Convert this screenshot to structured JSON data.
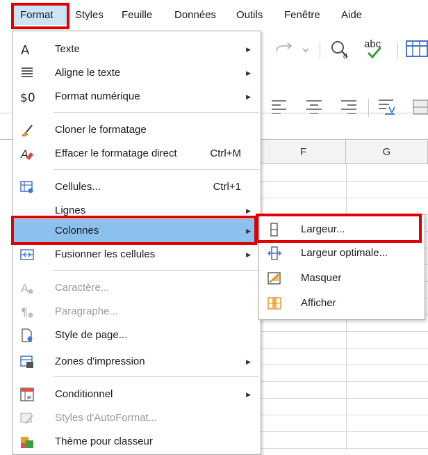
{
  "menubar": {
    "items": [
      {
        "label": "Format",
        "accel": "t"
      },
      {
        "label": "Styles",
        "accel": "y"
      },
      {
        "label": "Feuille",
        "accel": "u"
      },
      {
        "label": "Données",
        "accel": "s"
      },
      {
        "label": "Outils",
        "accel": "O"
      },
      {
        "label": "Fenêtre",
        "accel": "ê"
      },
      {
        "label": "Aide",
        "accel": "e"
      }
    ]
  },
  "grid": {
    "columns": [
      "F",
      "G"
    ]
  },
  "format_menu": {
    "items": [
      {
        "label": "Texte",
        "icon": "text-icon",
        "submenu": true
      },
      {
        "label": "Aligne le texte",
        "icon": "align-text-icon",
        "submenu": true
      },
      {
        "label": "Format numérique",
        "icon": "number-format-icon",
        "submenu": true
      },
      {
        "label": "Cloner le formatage",
        "icon": "clone-formatting-icon"
      },
      {
        "label": "Effacer le formatage direct",
        "icon": "clear-formatting-icon",
        "shortcut": "Ctrl+M"
      },
      {
        "label": "Cellules...",
        "icon": "cells-icon",
        "shortcut": "Ctrl+1"
      },
      {
        "label": "Lignes",
        "submenu": true
      },
      {
        "label": "Colonnes",
        "submenu": true,
        "state": "highlighted"
      },
      {
        "label": "Fusionner les cellules",
        "icon": "merge-cells-icon",
        "submenu": true
      },
      {
        "label": "Caractère...",
        "icon": "character-icon",
        "state": "disabled"
      },
      {
        "label": "Paragraphe...",
        "icon": "paragraph-icon",
        "state": "disabled"
      },
      {
        "label": "Style de page...",
        "icon": "page-style-icon"
      },
      {
        "label": "Zones d'impression",
        "icon": "print-ranges-icon",
        "submenu": true
      },
      {
        "label": "Conditionnel",
        "icon": "conditional-icon",
        "submenu": true
      },
      {
        "label": "Styles d'AutoFormat...",
        "icon": "autoformat-icon",
        "state": "disabled"
      },
      {
        "label": "Thème pour classeur",
        "icon": "theme-icon"
      }
    ]
  },
  "colonnes_submenu": {
    "items": [
      {
        "label": "Largeur...",
        "icon": "column-width-icon"
      },
      {
        "label": "Largeur optimale...",
        "icon": "optimal-width-icon"
      },
      {
        "label": "Masquer",
        "icon": "hide-columns-icon"
      },
      {
        "label": "Afficher",
        "icon": "show-columns-icon"
      }
    ]
  },
  "colors": {
    "highlight_red": "#e00000",
    "selection_blue": "#8cc1ee",
    "menu_border": "#a9a9a9"
  }
}
